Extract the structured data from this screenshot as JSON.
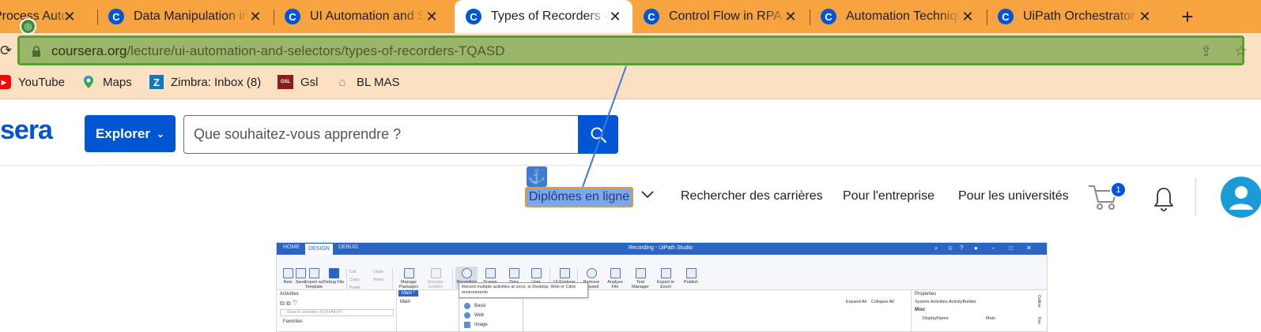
{
  "browser": {
    "tabs": [
      {
        "title": "Process Automation",
        "active": false
      },
      {
        "title": "Data Manipulation in UiPath",
        "active": false
      },
      {
        "title": "UI Automation and Selectors",
        "active": false
      },
      {
        "title": "Types of Recorders - RPA",
        "active": true
      },
      {
        "title": "Control Flow in RPA | Coursera",
        "active": false
      },
      {
        "title": "Automation Techniques",
        "active": false
      },
      {
        "title": "UiPath Orchestrator and",
        "active": false
      }
    ],
    "favicon_letter": "C",
    "close_glyph": "✕",
    "new_tab_glyph": "+",
    "url": {
      "host": "coursera.org",
      "path": "/lecture/ui-automation-and-selectors/types-of-recorders-TQASD"
    },
    "bookmarks": [
      {
        "label": "YouTube",
        "icon": "youtube-icon",
        "color": "#ff0000"
      },
      {
        "label": "Maps",
        "icon": "maps-pin-icon",
        "color": "#34a853"
      },
      {
        "label": "Zimbra: Inbox (8)",
        "icon": "zimbra-icon",
        "color": "#0b7bbd",
        "icon_text": "Z"
      },
      {
        "label": "Gsl",
        "icon": "gsl-icon",
        "color": "#8b1c1c",
        "icon_text": "GSL"
      },
      {
        "label": "BL MAS",
        "icon": "home-icon",
        "color": "#9aa0a6"
      }
    ]
  },
  "coursera": {
    "logo_fragment": "sera",
    "explorer_label": "Explorer",
    "search_placeholder": "Que souhaitez-vous apprendre ?",
    "nav": {
      "diplomes": "Diplômes en ligne",
      "careers": "Rechercher des carrières",
      "enterprise": "Pour l'entreprise",
      "universities": "Pour les universités"
    },
    "cart_count": "1",
    "brand_color": "#0056d2"
  },
  "video": {
    "tabs": [
      "HOME",
      "DESIGN",
      "DEBUG"
    ],
    "active_tab": "DESIGN",
    "window_title": "Recording - UiPath Studio",
    "ribbon": [
      {
        "label": "New",
        "disabled": false
      },
      {
        "label": "Save",
        "disabled": false
      },
      {
        "label": "Export as Template",
        "disabled": false
      },
      {
        "label": "Debug File",
        "disabled": false
      },
      {
        "label": "Manage Packages",
        "disabled": false
      },
      {
        "label": "Manage Entities",
        "disabled": true
      },
      {
        "label": "Recording",
        "disabled": false,
        "selected": true
      },
      {
        "label": "Screen Scraping",
        "disabled": false
      },
      {
        "label": "Data Scraping",
        "disabled": false
      },
      {
        "label": "User Events",
        "disabled": false
      },
      {
        "label": "UI Explorer",
        "disabled": false
      },
      {
        "label": "Remove Unused",
        "disabled": false
      },
      {
        "label": "Analyze File",
        "disabled": false
      },
      {
        "label": "Test Manager",
        "disabled": false
      },
      {
        "label": "Export to Excel",
        "disabled": false
      },
      {
        "label": "Publish",
        "disabled": false
      }
    ],
    "clipboard": {
      "cut": "Cut",
      "copy": "Copy",
      "paste": "Paste",
      "undo": "Undo",
      "redo": "Redo"
    },
    "activities_title": "Activities",
    "activities_search": "Search activities (Ctrl+Alt+F)",
    "favorites": "Favorites",
    "doc_tab": "Main *",
    "doc_breadcrumb": "Main",
    "expand_all": "Expand All",
    "collapse_all": "Collapse All",
    "tooltip": "Record multiple activities at once, in Desktop, Web or Citrix environments",
    "recording_menu": [
      "Basic",
      "Web",
      "Image"
    ],
    "properties_title": "Properties",
    "properties_type": "System.Activities.ActivityBuilder",
    "misc": "Misc",
    "display_name_label": "DisplayName",
    "display_name_value": "Main",
    "side_tabs": [
      "Outline",
      "Res"
    ]
  }
}
